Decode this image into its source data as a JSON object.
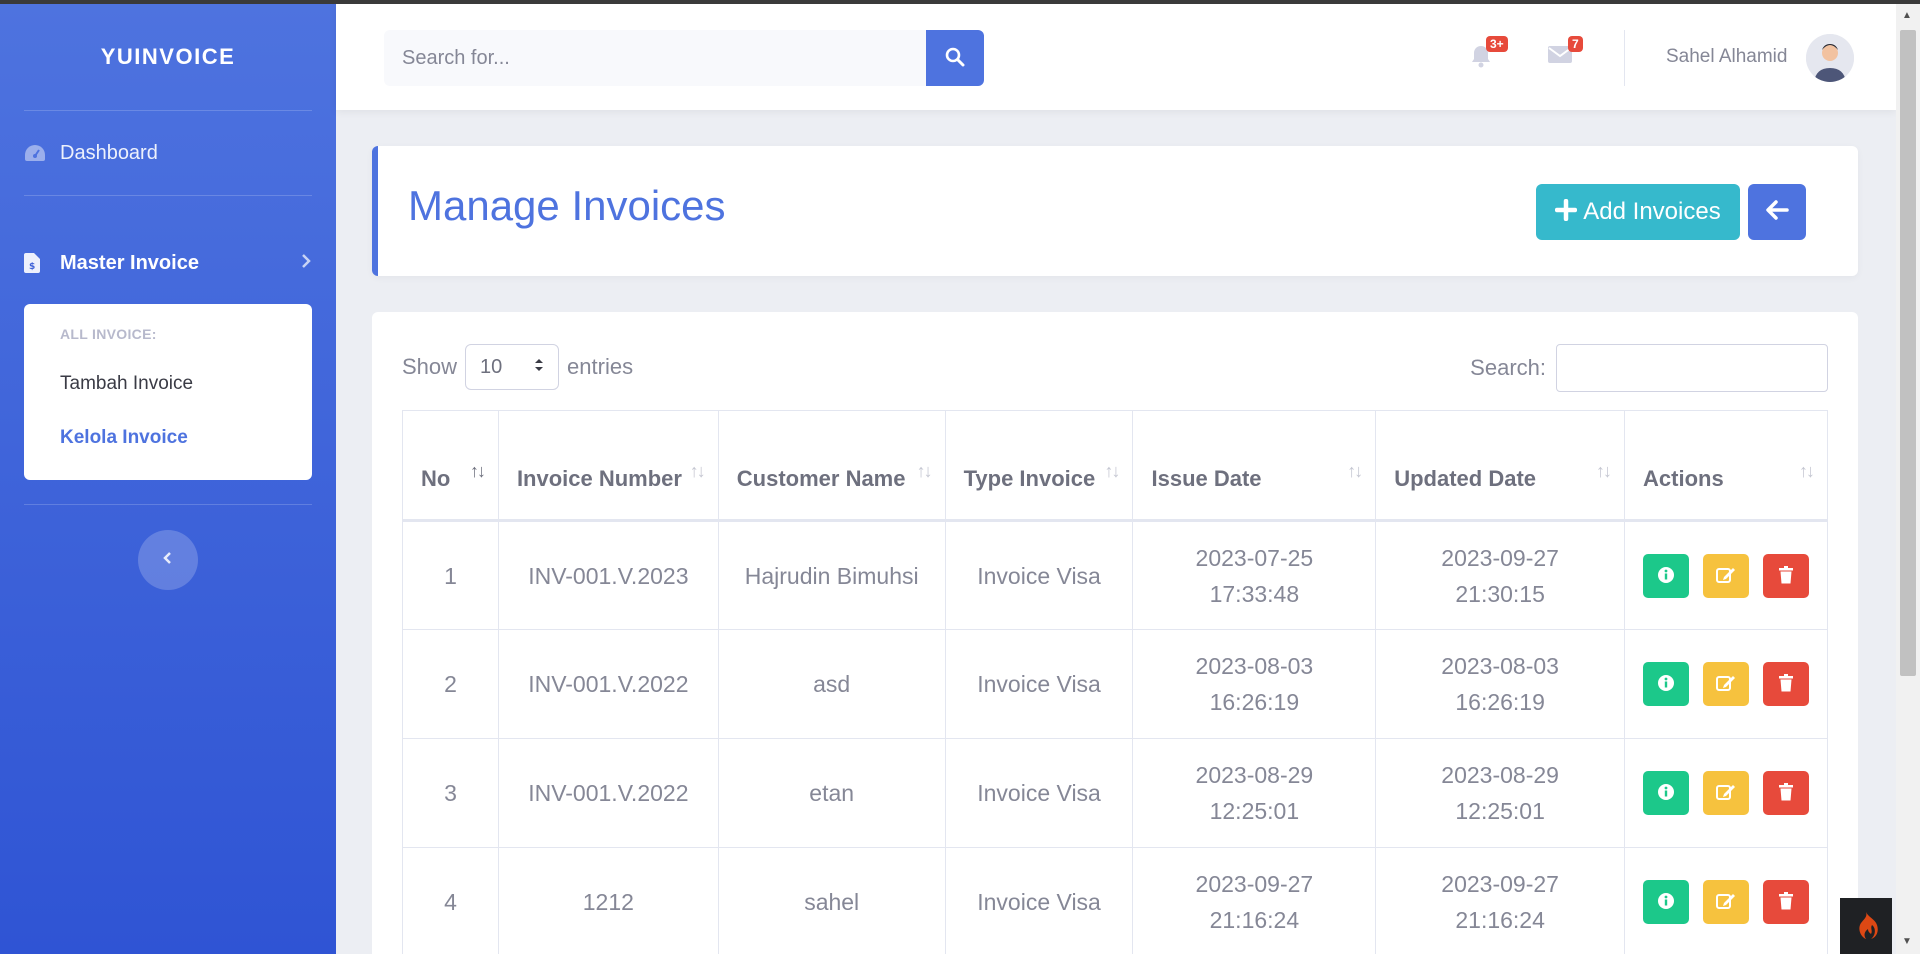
{
  "brand": "YUINVOICE",
  "sidebar": {
    "dashboard_label": "Dashboard",
    "master_label": "Master Invoice",
    "submenu_heading": "ALL INVOICE:",
    "submenu_items": [
      "Tambah Invoice",
      "Kelola Invoice"
    ],
    "active_item": "Kelola Invoice"
  },
  "topbar": {
    "search_placeholder": "Search for...",
    "alerts_badge": "3+",
    "messages_badge": "7",
    "user_name": "Sahel Alhamid"
  },
  "header": {
    "title": "Manage Invoices",
    "add_button_label": "Add Invoices"
  },
  "table_controls": {
    "show_label": "Show",
    "entries_value": "10",
    "entries_label": "entries",
    "search_label": "Search:"
  },
  "table": {
    "columns": [
      "No",
      "Invoice Number",
      "Customer Name",
      "Type Invoice",
      "Issue Date",
      "Updated Date",
      "Actions"
    ],
    "rows": [
      {
        "no": "1",
        "invoice_number": "INV-001.V.2023",
        "customer": "Hajrudin Bimuhsi",
        "type": "Invoice Visa",
        "issue_date": "2023-07-25",
        "issue_time": "17:33:48",
        "updated_date": "2023-09-27",
        "updated_time": "21:30:15"
      },
      {
        "no": "2",
        "invoice_number": "INV-001.V.2022",
        "customer": "asd",
        "type": "Invoice Visa",
        "issue_date": "2023-08-03",
        "issue_time": "16:26:19",
        "updated_date": "2023-08-03",
        "updated_time": "16:26:19"
      },
      {
        "no": "3",
        "invoice_number": "INV-001.V.2022",
        "customer": "etan",
        "type": "Invoice Visa",
        "issue_date": "2023-08-29",
        "issue_time": "12:25:01",
        "updated_date": "2023-08-29",
        "updated_time": "12:25:01"
      },
      {
        "no": "4",
        "invoice_number": "1212",
        "customer": "sahel",
        "type": "Invoice Visa",
        "issue_date": "2023-09-27",
        "issue_time": "21:16:24",
        "updated_date": "2023-09-27",
        "updated_time": "21:16:24"
      }
    ]
  },
  "colors": {
    "primary": "#4e73df",
    "info": "#36b9cc",
    "success": "#1cc88a",
    "warning": "#f6c23e",
    "danger": "#e74a3b"
  },
  "icons": {
    "dashboard": "tachometer-icon",
    "master": "file-invoice-icon",
    "search": "search-icon",
    "alerts": "bell-icon",
    "messages": "envelope-icon",
    "back": "arrow-left-icon",
    "view": "info-icon",
    "edit": "edit-icon",
    "delete": "trash-icon"
  }
}
